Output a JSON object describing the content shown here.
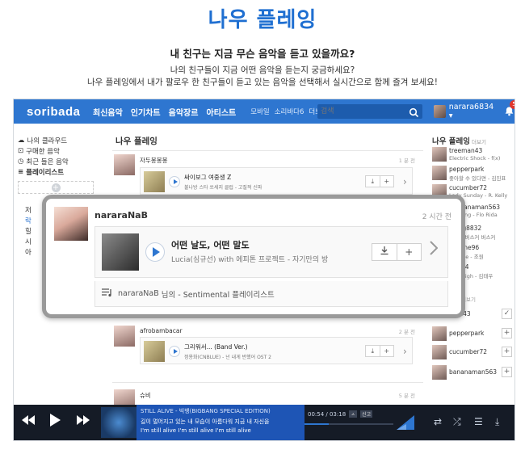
{
  "hero": {
    "title": "나우 플레잉",
    "subtitle": "내 친구는 지금 무슨 음악을 듣고 있을까요?",
    "desc1": "나의 친구들이 지금 어떤 음악을 듣는지 궁금하세요?",
    "desc2": "나우 플레잉에서 내가 팔로우 한 친구들이 듣고 있는 음악을 선택해서 실시간으로 함께 즐겨 보세요!"
  },
  "topbar": {
    "logo": "soribada",
    "nav_main": [
      "최신음악",
      "인기차트",
      "음악장르",
      "아티스트"
    ],
    "nav_sub": [
      "모바일",
      "소리바다6",
      "더보기 ▾"
    ],
    "search_placeholder": "검색",
    "user_name": "narara6834 ▾",
    "notif_count": "5"
  },
  "lsidebar": {
    "items": [
      "나의 클라우드",
      "구매한 음악",
      "최근 들은 음악",
      "플레이리스트"
    ],
    "partial": [
      "저",
      "락",
      "힐",
      "시",
      "아"
    ]
  },
  "main": {
    "title": "나우 플레잉",
    "cards": [
      {
        "user": "자두봉봉봉",
        "time": "1 분 전",
        "song": "싸이보그 여중생 Z",
        "artist": "불나방 스타 쏘세지 클럽 - 고질적 신파"
      },
      {
        "user": "afrobambacar",
        "time": "2 분 전",
        "song": "그리워서... (Band Ver.)",
        "artist": "정용화(CNBLUE) - 넌 내게 반했어 OST 2"
      },
      {
        "user": "슈비",
        "time": "5 분 전"
      }
    ]
  },
  "rsidebar": {
    "title": "나우 플레잉",
    "more": "더보기",
    "now": [
      {
        "name": "treeman43",
        "song": "Electric Shock - f(x)"
      },
      {
        "name": "pepperpark",
        "song": "좋아할 수 있다면 - 김진표"
      },
      {
        "name": "cucumber72",
        "song": "Lady Sunday - R. Kelly"
      },
      {
        "name": "bananaman563",
        "song": "Feeling - Flo Rida"
      },
      {
        "name": "dog8832",
        "song": "이 - 버스커 버스커"
      },
      {
        "name": "rline96",
        "song": "One - 조원"
      },
      {
        "name": "34",
        "song": "High - 김태우"
      }
    ],
    "follow_more": "더보기",
    "follow": [
      {
        "name": "nan43",
        "action": "✓"
      },
      {
        "name": "pepperpark",
        "action": "+"
      },
      {
        "name": "cucumber72",
        "action": "+"
      },
      {
        "name": "bananaman563",
        "action": "+"
      }
    ]
  },
  "player": {
    "title": "STILL ALIVE - 빅뱅(BIGBANG SPECIAL EDITION)",
    "lyric1": "길이 멀어지고 있는 내 모습이 아름다워 지금 내 자신을",
    "lyric2": "I'm still alive I'm still alive I'm still alive",
    "time": "00:54 / 03:18",
    "badge1": "ㅅ",
    "badge2": "신고",
    "progress": 0.27
  },
  "popup": {
    "name": "nararaNaB",
    "time": "2 시간 전",
    "song": "어떤 날도, 어떤 말도",
    "artist": "Lucia(심규선) with 에피톤 프로젝트 - 자기만의 방",
    "foot_user": "nararaNaB",
    "foot_text": "님의 - Sentimental 플레이리스트",
    "add_label": "+"
  }
}
